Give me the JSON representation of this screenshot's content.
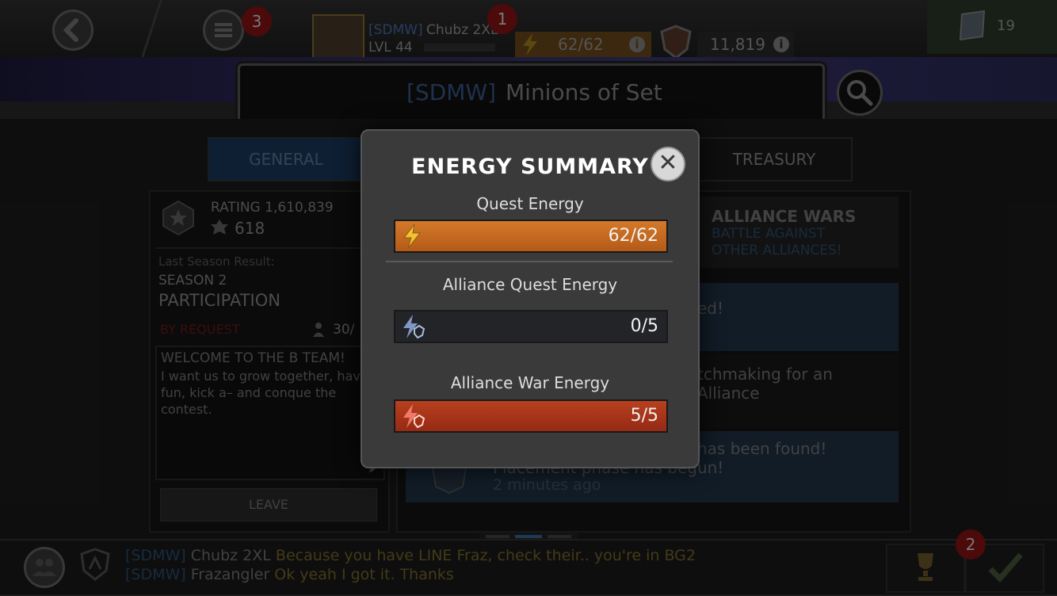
{
  "top": {
    "notifications_count": "3",
    "player_tag": "[SDMW]",
    "player_name": "Chubz 2XL",
    "player_level": "LVL 44",
    "player_badge": "1",
    "energy_display": "62/62",
    "rating_display": "11,819",
    "units_count": "19"
  },
  "alliance": {
    "tag": "[SDMW]",
    "name": "Minions of Set"
  },
  "tabs": {
    "general": "GENERAL",
    "treasury": "TREASURY"
  },
  "left_panel": {
    "rating_label": "RATING 1,610,839",
    "rank_value": "618",
    "last_season_label": "Last Season Result:",
    "season": "SEASON 2",
    "participation": "PARTICIPATION",
    "by_request": "BY REQUEST",
    "members": "30/",
    "welcome_title": "WELCOME TO THE B TEAM!",
    "welcome_body": "I want us to grow together, have fun, kick a– and conque the contest.",
    "leave_label": "LEAVE"
  },
  "right_panel": {
    "wars_title": "ALLIANCE WARS",
    "wars_sub_1": "BATTLE AGAINST",
    "wars_sub_2": "OTHER ALLIANCES!",
    "feed_1": "ed!",
    "feed_2": "tchmaking for an Alliance",
    "feed_3_a": "has been found!",
    "feed_3_b": "Placement phase has begun!",
    "feed_3_time": "2 minutes ago"
  },
  "chat": {
    "line1_tag": "[SDMW]",
    "line1_name": "Chubz 2XL",
    "line1_msg": "Because you have LINE Fraz, check their.. you're in BG2",
    "line2_tag": "[SDMW]",
    "line2_name": "Frazangler",
    "line2_msg": "Ok yeah I got it. Thanks",
    "right_badge": "2"
  },
  "modal": {
    "title": "ENERGY SUMMARY",
    "close_icon": "close-icon",
    "quest_label": "Quest Energy",
    "quest_value": "62/62",
    "quest_fraction": 1.0,
    "aq_label": "Alliance Quest Energy",
    "aq_value": "0/5",
    "aq_fraction": 0.0,
    "aw_label": "Alliance War Energy",
    "aw_value": "5/5",
    "aw_fraction": 1.0,
    "colors": {
      "quest": "#c0661f",
      "aw": "#a8321a",
      "aq_track": "#222428"
    }
  }
}
